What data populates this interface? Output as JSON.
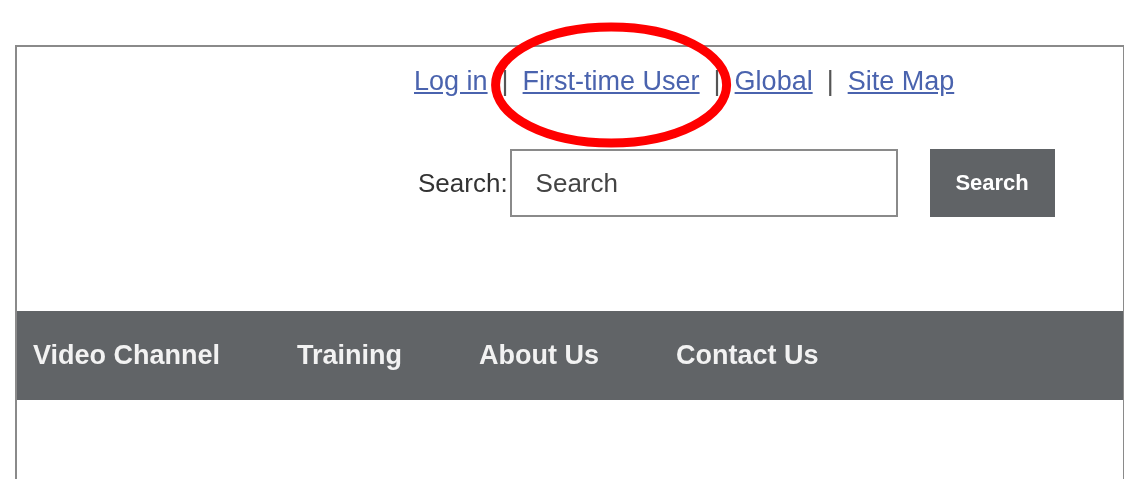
{
  "top_links": [
    {
      "label": "Log in"
    },
    {
      "label": "First-time User"
    },
    {
      "label": "Global"
    },
    {
      "label": "Site Map"
    }
  ],
  "link_separator": "|",
  "search": {
    "label": "Search:",
    "placeholder": "Search",
    "button": "Search"
  },
  "nav": {
    "items": [
      "Video Channel",
      "Training",
      "About Us",
      "Contact Us"
    ]
  },
  "annotation": {
    "kind": "ellipse"
  }
}
